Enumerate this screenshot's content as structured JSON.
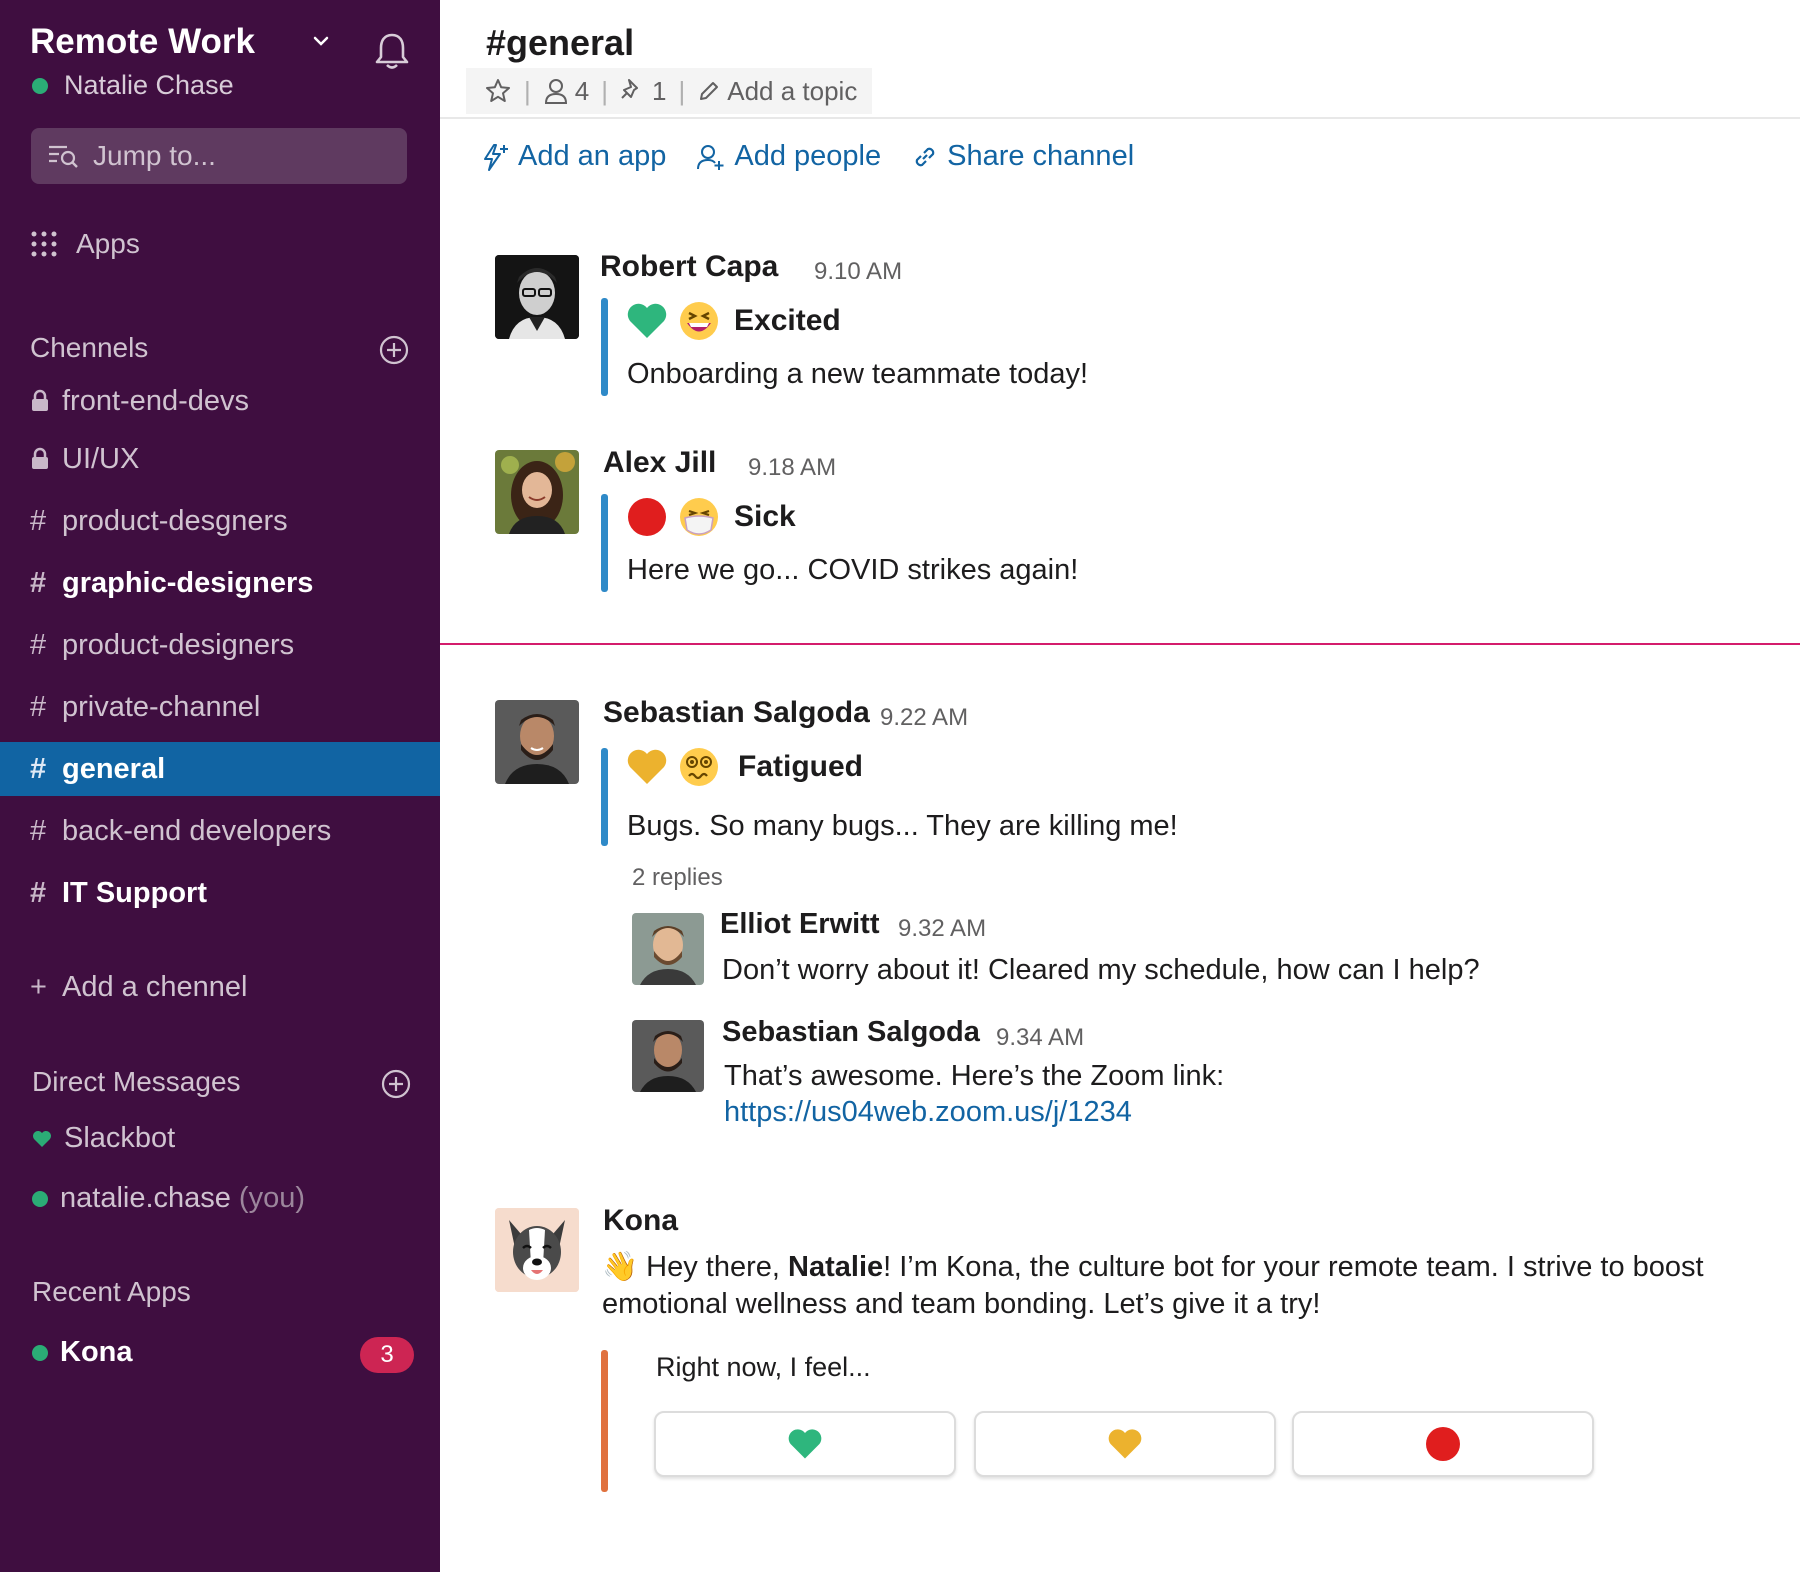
{
  "workspace": {
    "name": "Remote Work",
    "user": "Natalie Chase"
  },
  "search": {
    "placeholder": "Jump to..."
  },
  "sidebar": {
    "apps_label": "Apps",
    "channels_heading": "Chennels",
    "channels": [
      {
        "prefix": "lock",
        "name": "front-end-devs",
        "bold": false,
        "active": false
      },
      {
        "prefix": "lock",
        "name": "UI/UX",
        "bold": false,
        "active": false
      },
      {
        "prefix": "#",
        "name": "product-desgners",
        "bold": false,
        "active": false
      },
      {
        "prefix": "#",
        "name": "graphic-designers",
        "bold": true,
        "active": false
      },
      {
        "prefix": "#",
        "name": "product-designers",
        "bold": false,
        "active": false
      },
      {
        "prefix": "#",
        "name": "private-channel",
        "bold": false,
        "active": false
      },
      {
        "prefix": "#",
        "name": "general",
        "bold": true,
        "active": true
      },
      {
        "prefix": "#",
        "name": "back-end developers",
        "bold": false,
        "active": false
      },
      {
        "prefix": "#",
        "name": "IT Support",
        "bold": true,
        "active": false
      }
    ],
    "add_channel_label": "Add a chennel",
    "dm_heading": "Direct Messages",
    "dms": [
      {
        "name": "Slackbot",
        "suffix": "",
        "icon": "heart"
      },
      {
        "name": "natalie.chase",
        "suffix": "(you)",
        "icon": "online-dot"
      }
    ],
    "recent_apps_heading": "Recent Apps",
    "recent_apps": [
      {
        "name": "Kona",
        "badge": "3"
      }
    ]
  },
  "channel": {
    "title": "#general",
    "members": "4",
    "pins": "1",
    "topic_label": "Add a topic",
    "actions": {
      "add_app": "Add an app",
      "add_people": "Add people",
      "share": "Share channel"
    }
  },
  "messages": [
    {
      "author": "Robert Capa",
      "time": "9.10 AM",
      "mood": "Excited",
      "mood_color": "#2eb67d",
      "emoji": "grinning-squinting-face",
      "text": "Onboarding a new teammate today!"
    },
    {
      "author": "Alex Jill",
      "time": "9.18 AM",
      "mood": "Sick",
      "mood_color": "#e01e1e",
      "emoji": "face-with-medical-mask",
      "text": "Here we go... COVID strikes again!"
    },
    {
      "author": "Sebastian Salgoda",
      "time": "9.22 AM",
      "mood": "Fatigued",
      "mood_color": "#ecb22e",
      "emoji": "dizzy-face",
      "text": "Bugs. So many bugs... They are killing me!",
      "replies_label": "2 replies"
    }
  ],
  "thread": [
    {
      "author": "Elliot Erwitt",
      "time": "9.32 AM",
      "text": "Don’t worry about it! Cleared my schedule, how can I help?"
    },
    {
      "author": "Sebastian Salgoda",
      "time": "9.34 AM",
      "text": "That’s awesome. Here’s the Zoom link:",
      "link": "https://us04web.zoom.us/j/1234"
    }
  ],
  "bot": {
    "author": "Kona",
    "emoji": "👋",
    "intro_pre": "Hey there,",
    "intro_name": "Natalie",
    "intro_post": "! I’m Kona, the culture bot for your remote team. I strive to boost",
    "intro_line2": "emotional wellness and team bonding. Let’s give it a try!",
    "prompt": "Right now, I feel...",
    "options": [
      {
        "icon": "green-heart",
        "color": "#2eb67d"
      },
      {
        "icon": "yellow-heart",
        "color": "#ecb22e"
      },
      {
        "icon": "red-circle",
        "color": "#e01e1e"
      }
    ]
  },
  "colors": {
    "sidebar_bg": "#3f0e40",
    "active_channel": "#1164a3",
    "link": "#1264a3",
    "new_divider": "#d41c6c",
    "badge": "#cd2553"
  }
}
